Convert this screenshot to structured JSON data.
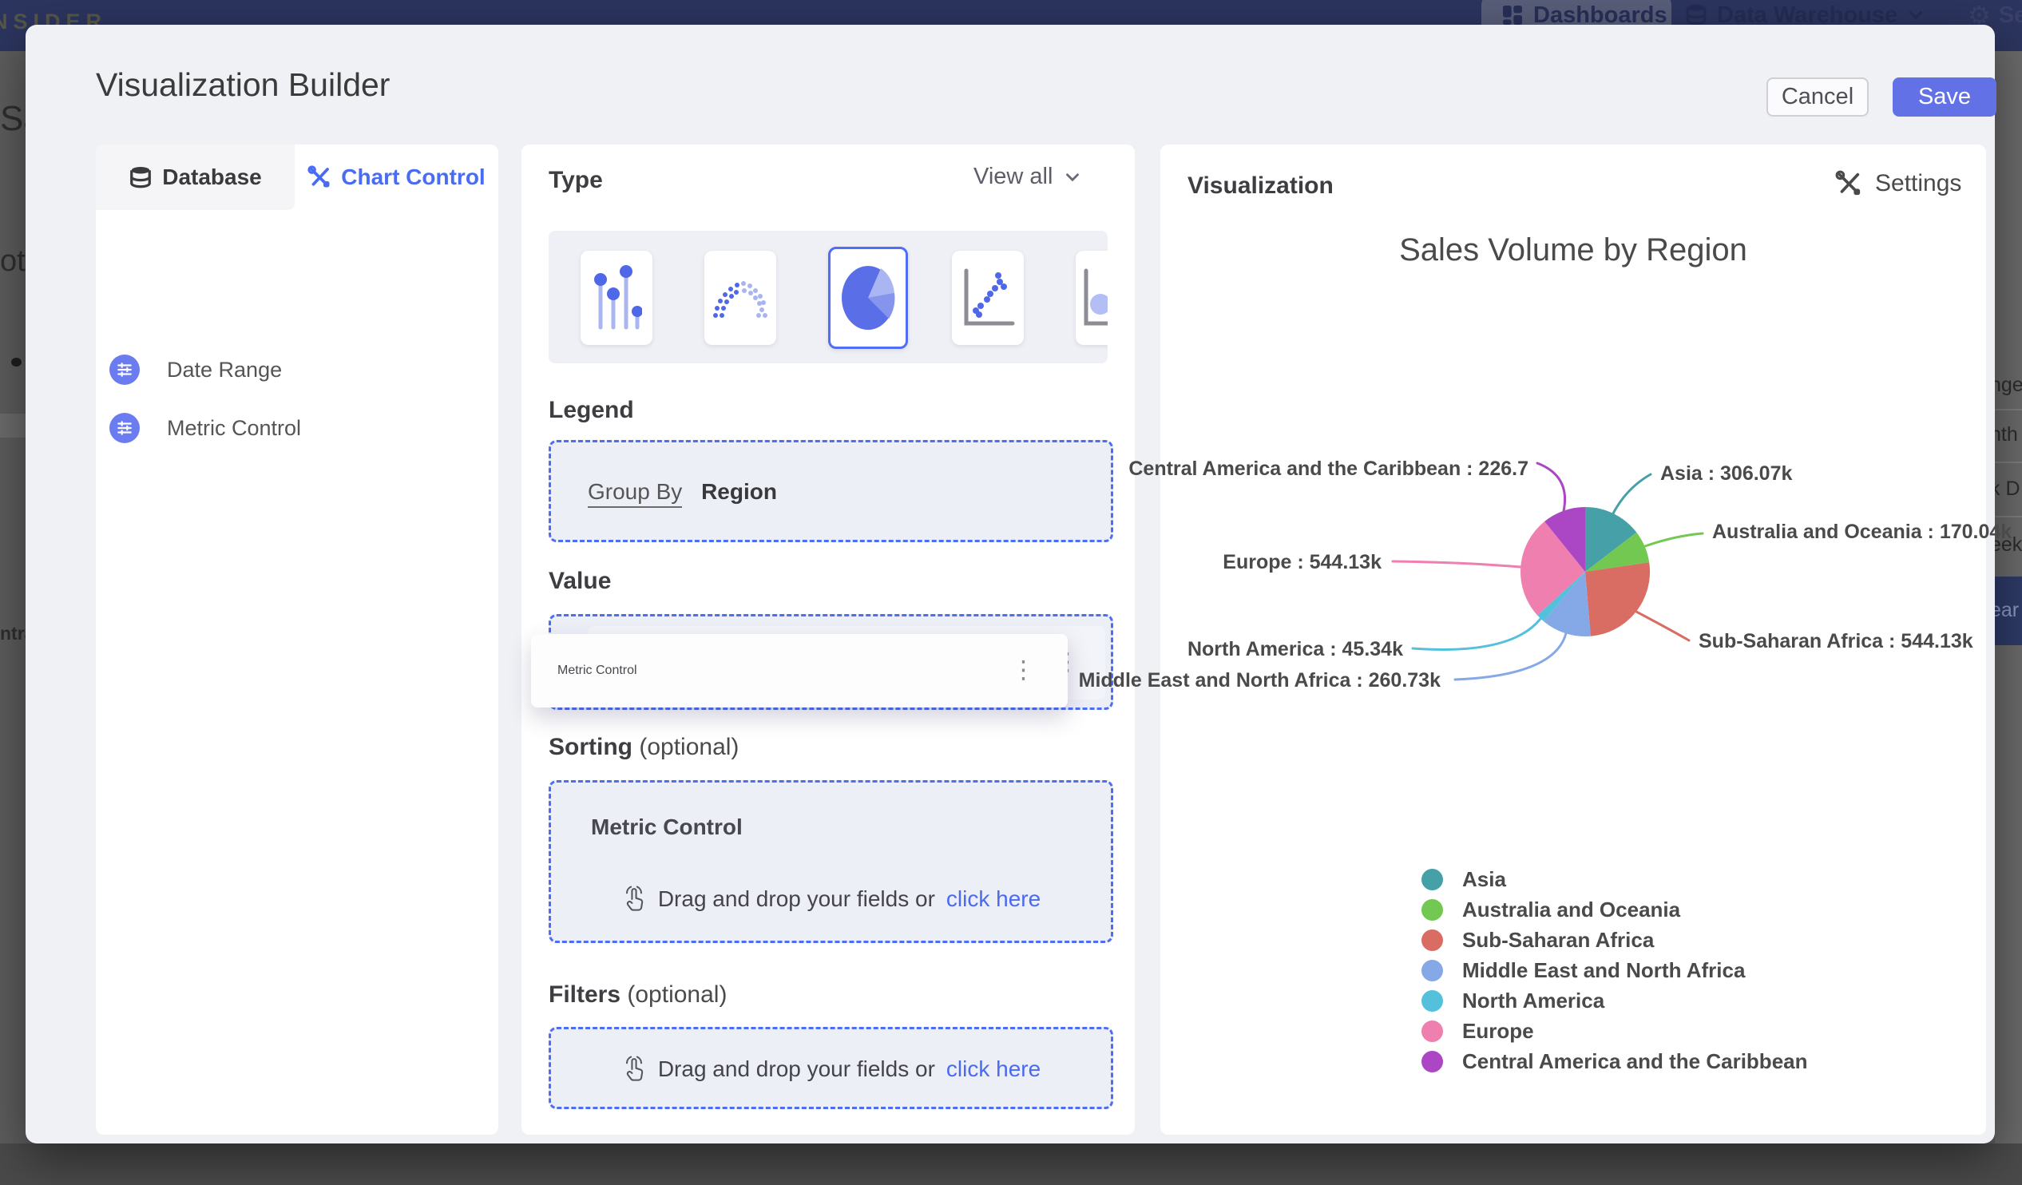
{
  "background": {
    "logo": "NSIDER",
    "nav": {
      "dashboards": "Dashboards",
      "data_warehouse": "Data Warehouse",
      "settings_partial": "Se"
    },
    "left_fragments": {
      "f1": "Sal",
      "f2": "ota",
      "f3": "ntral"
    },
    "right_fragments": {
      "f1": "nge",
      "f2": "nth",
      "f3": "k D",
      "f4": "eek",
      "f5": "ear"
    }
  },
  "modal": {
    "title": "Visualization Builder",
    "cancel_label": "Cancel",
    "save_label": "Save",
    "sidebar": {
      "tabs": [
        {
          "label": "Database"
        },
        {
          "label": "Chart Control"
        }
      ],
      "items": [
        {
          "label": "Date Range"
        },
        {
          "label": "Metric Control"
        }
      ]
    },
    "builder": {
      "type_label": "Type",
      "view_all": "View all",
      "legend_label": "Legend",
      "group_by": "Group By",
      "group_value": "Region",
      "value_label": "Value",
      "value_chip": "Metric Control",
      "drag_chip": "Metric Control",
      "sorting_label": "Sorting",
      "optional_suffix": "(optional)",
      "sorting_chip": "Metric Control",
      "filters_label": "Filters",
      "dnd_text": "Drag and drop your fields or",
      "dnd_link": "click here"
    },
    "viz": {
      "header": "Visualization",
      "settings": "Settings"
    }
  },
  "colors": {
    "accent_blue": "#4a6cf2",
    "save_blue": "#6271e6",
    "dashed_border": "#4d6df2",
    "link_blue": "#4a6af0"
  },
  "chart_data": {
    "type": "pie",
    "title": "Sales Volume by Region",
    "legend_position": "bottom-left",
    "slices": [
      {
        "name": "Asia",
        "value": 306.07,
        "display": "Asia : 306.07k",
        "color": "#46a0a8"
      },
      {
        "name": "Australia and Oceania",
        "value": 170.04,
        "display": "Australia and Oceania : 170.04k",
        "color": "#72c850"
      },
      {
        "name": "Sub-Saharan Africa",
        "value": 544.13,
        "display": "Sub-Saharan Africa : 544.13k",
        "color": "#d96c63"
      },
      {
        "name": "Middle East and North Africa",
        "value": 260.73,
        "display": "Middle East and North Africa : 260.73k",
        "color": "#85a8e6"
      },
      {
        "name": "North America",
        "value": 45.34,
        "display": "North America : 45.34k",
        "color": "#54c0dc"
      },
      {
        "name": "Europe",
        "value": 544.13,
        "display": "Europe : 544.13k",
        "color": "#ee7fae"
      },
      {
        "name": "Central America and the Caribbean",
        "value": 226.77,
        "display": "Central America and the Caribbean : 226.7",
        "color": "#ab46c4"
      }
    ]
  }
}
